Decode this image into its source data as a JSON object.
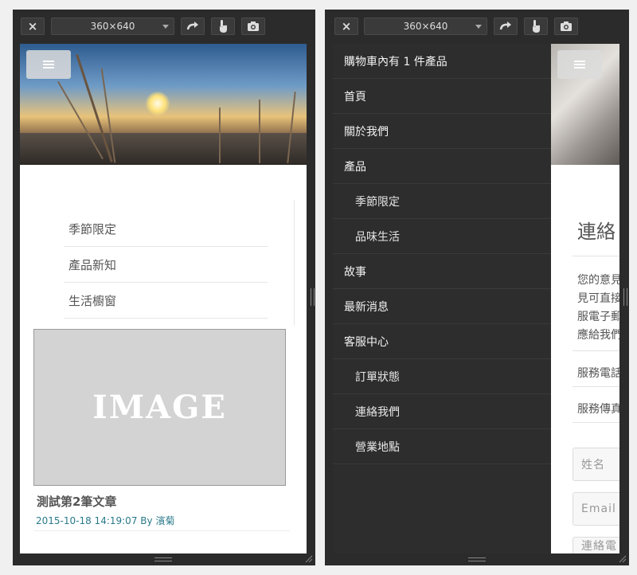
{
  "panels": [
    {
      "close": "×",
      "size": "360×640"
    },
    {
      "close": "×",
      "size": "360×640"
    }
  ],
  "left": {
    "categories": [
      "季節限定",
      "產品新知",
      "生活櫥窗"
    ],
    "image_placeholder": "IMAGE",
    "post_title": "測試第2筆文章",
    "post_date": "2015-10-18 14:19:07",
    "post_by": "By",
    "post_author": "濱菊"
  },
  "drawer": {
    "cart": "購物車內有 1 件產品",
    "items": [
      {
        "label": "首頁",
        "sub": false
      },
      {
        "label": "關於我們",
        "sub": false
      },
      {
        "label": "產品",
        "sub": false
      },
      {
        "label": "季節限定",
        "sub": true
      },
      {
        "label": "品味生活",
        "sub": true
      },
      {
        "label": "故事",
        "sub": false
      },
      {
        "label": "最新消息",
        "sub": false
      },
      {
        "label": "客服中心",
        "sub": false
      },
      {
        "label": "訂單狀態",
        "sub": true
      },
      {
        "label": "連絡我們",
        "sub": true
      },
      {
        "label": "營業地點",
        "sub": true
      }
    ]
  },
  "behind": {
    "heading": "連絡",
    "para": [
      "您的意見",
      "見可直接",
      "服電子郵",
      "應給我們"
    ],
    "phone": "服務電話",
    "fax": "服務傳真",
    "name_ph": "姓名",
    "email_ph": "Email",
    "phone_ph": "連絡電話"
  },
  "colors": {
    "drawer_bg": "#2d2d2d",
    "meta_link": "#2a7a8a"
  }
}
